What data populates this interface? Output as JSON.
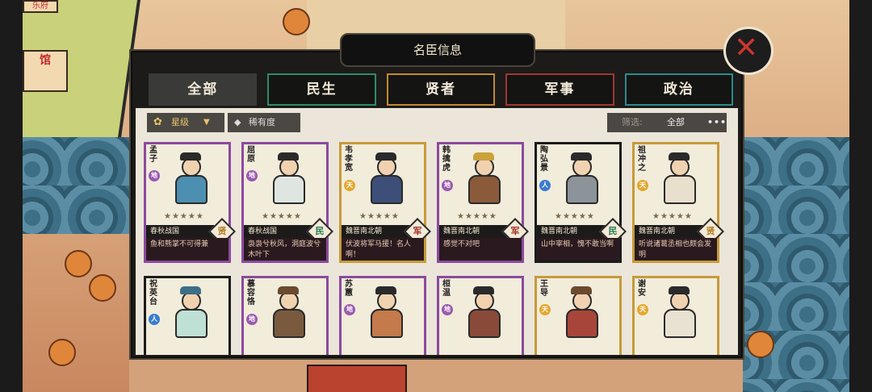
{
  "panel": {
    "title": "名臣信息",
    "tabs": [
      {
        "label": "全部",
        "active": true
      },
      {
        "label": "民生",
        "active": false
      },
      {
        "label": "贤者",
        "active": false
      },
      {
        "label": "军事",
        "active": false
      },
      {
        "label": "政治",
        "active": false
      }
    ],
    "sort_label": "星级",
    "rarity_label": "稀有度",
    "filter_label": "筛选:",
    "filter_value": "全部",
    "more_label": "•••"
  },
  "background": {
    "badge_text": "馆",
    "top_badge_text": "乐府"
  },
  "cards": [
    {
      "name": "孟子",
      "rank": "地",
      "era": "春秋战国",
      "category": "贤",
      "stars": "★★★★★",
      "quote": "鱼和熊掌不可得兼",
      "border": "purple"
    },
    {
      "name": "屈原",
      "rank": "地",
      "era": "春秋战国",
      "category": "民",
      "stars": "★★★★★",
      "quote": "袅袅兮秋风，洞庭波兮木叶下",
      "border": "purple"
    },
    {
      "name": "韦孝宽",
      "rank": "天",
      "era": "魏晋南北朝",
      "category": "军",
      "stars": "★★★★★",
      "quote": "伏波将军马援！名人啊！",
      "border": "gold"
    },
    {
      "name": "韩擒虎",
      "rank": "地",
      "era": "魏晋南北朝",
      "category": "军",
      "stars": "★★★★★",
      "quote": "感觉不对吧",
      "border": "purple"
    },
    {
      "name": "陶弘景",
      "rank": "人",
      "era": "魏晋南北朝",
      "category": "民",
      "stars": "★★★★★",
      "quote": "山中宰相，愧不敢当啊",
      "border": "black"
    },
    {
      "name": "祖冲之",
      "rank": "天",
      "era": "魏晋南北朝",
      "category": "贤",
      "stars": "★★★★★",
      "quote": "听说诸葛丞相也颇会发明",
      "border": "gold"
    },
    {
      "name": "祝英台",
      "rank": "人",
      "border": "black"
    },
    {
      "name": "慕容恪",
      "rank": "地",
      "border": "purple"
    },
    {
      "name": "苏蕙",
      "rank": "地",
      "border": "purple"
    },
    {
      "name": "桓温",
      "rank": "地",
      "border": "purple"
    },
    {
      "name": "王导",
      "rank": "天",
      "border": "gold"
    },
    {
      "name": "谢安",
      "rank": "天",
      "border": "gold"
    }
  ],
  "colors": {
    "tab_min": "#2f8a67",
    "tab_xian": "#c28a2d",
    "tab_jun": "#a33630",
    "tab_zheng": "#2c8a8c",
    "border_purple": "#8b4a9e",
    "border_gold": "#c79a3a"
  }
}
